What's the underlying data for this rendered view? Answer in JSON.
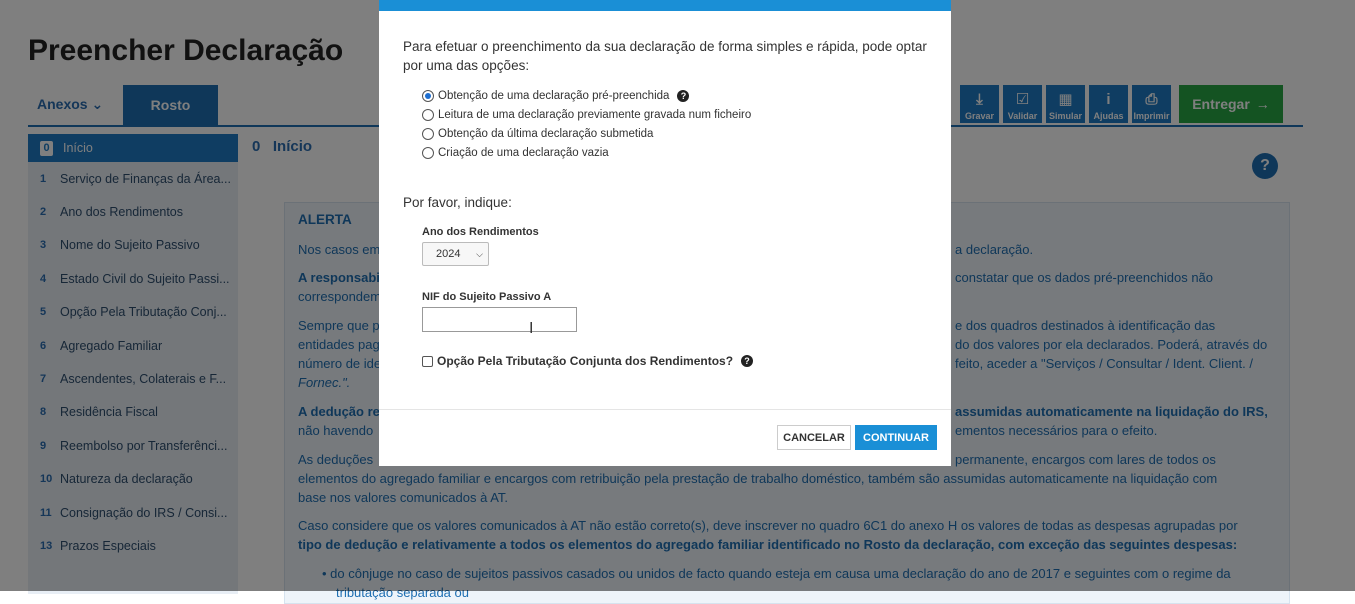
{
  "page": {
    "title": "Preencher Declaração",
    "anexos_label": "Anexos",
    "rosto_tab": "Rosto",
    "toolbar": [
      {
        "label": "Gravar",
        "icon": "download-icon"
      },
      {
        "label": "Validar",
        "icon": "check-icon"
      },
      {
        "label": "Simular",
        "icon": "calculator-icon"
      },
      {
        "label": "Ajudas",
        "icon": "info-icon"
      },
      {
        "label": "Imprimir",
        "icon": "printer-icon"
      }
    ],
    "entregar_label": "Entregar",
    "section_number": "0",
    "section_title": "Início",
    "sidebar": [
      {
        "num": "0",
        "label": "Início"
      },
      {
        "num": "1",
        "label": "Serviço de Finanças da Área..."
      },
      {
        "num": "2",
        "label": "Ano dos Rendimentos"
      },
      {
        "num": "3",
        "label": "Nome do Sujeito Passivo"
      },
      {
        "num": "4",
        "label": "Estado Civil do Sujeito Passi..."
      },
      {
        "num": "5",
        "label": "Opção Pela Tributação Conj..."
      },
      {
        "num": "6",
        "label": "Agregado Familiar"
      },
      {
        "num": "7",
        "label": "Ascendentes, Colaterais e F..."
      },
      {
        "num": "8",
        "label": "Residência Fiscal"
      },
      {
        "num": "9",
        "label": "Reembolso por Transferênci..."
      },
      {
        "num": "10",
        "label": "Natureza da declaração"
      },
      {
        "num": "11",
        "label": "Consignação do IRS / Consi..."
      },
      {
        "num": "13",
        "label": "Prazos Especiais"
      }
    ],
    "alert": {
      "title": "ALERTA",
      "p1_left": "Nos casos em",
      "p1_right": "a declaração.",
      "p2_left": "A responsabil",
      "p2_left2": "correspondem",
      "p2_right": "constatar que os dados pré-preenchidos não",
      "p3_l1": "Sempre que p",
      "p3_l2": "entidades pag",
      "p3_l3": "número de ide",
      "p3_r1": "e dos quadros destinados à identificação das",
      "p3_r2": "do dos valores por ela declarados. Poderá, através do",
      "p3_r3": "feito, aceder a \"Serviços / Consultar / Ident. Client. /",
      "p3_r4": "Fornec.\".",
      "p4_l1": "A dedução rel",
      "p4_l2": "não havendo",
      "p4_r1": "assumidas automaticamente na liquidação do IRS,",
      "p4_r2": "ementos necessários para o efeito.",
      "p5_l1": "As deduções",
      "p5_r1": "permanente, encargos com lares de todos os",
      "p5_l2": "elementos do agregado familiar e encargos com retribuição pela prestação de trabalho doméstico, também são assumidas automaticamente na liquidação com",
      "p5_l3": "base nos valores comunicados à AT.",
      "p6_l1": "Caso considere que os valores comunicados à AT não estão correto(s), deve inscrever no quadro 6C1 do anexo H os valores de todas as despesas agrupadas por",
      "p6_l2": "tipo de dedução e relativamente a todos os elementos do agregado familiar identificado no Rosto da declaração, com exceção das seguintes despesas:",
      "bullet1": "• do cônjuge no caso de sujeitos passivos casados ou unidos de facto quando esteja em causa uma declaração do ano de 2017 e seguintes com o regime da",
      "bullet1_l2": "tributação separada ou"
    }
  },
  "modal": {
    "intro": "Para efetuar o preenchimento da sua declaração de forma simples e rápida, pode optar por uma das opções:",
    "options": [
      {
        "label": "Obtenção de uma declaração pré-preenchida",
        "selected": true
      },
      {
        "label": "Leitura de uma declaração previamente gravada num ficheiro",
        "selected": false
      },
      {
        "label": "Obtenção da última declaração submetida",
        "selected": false
      },
      {
        "label": "Criação de uma declaração vazia",
        "selected": false
      }
    ],
    "please_indicate": "Por favor, indique:",
    "year_label": "Ano dos Rendimentos",
    "year_value": "2024",
    "nif_label": "NIF do Sujeito Passivo A",
    "nif_value": "",
    "joint_label": "Opção Pela Tributação Conjunta dos Rendimentos?",
    "cancel_label": "CANCELAR",
    "continue_label": "CONTINUAR"
  },
  "colors": {
    "primary": "#1f7bc4",
    "modal_accent": "#1a8fd6",
    "entregar": "#28a745",
    "sidebar_bg": "#e8eef5"
  }
}
